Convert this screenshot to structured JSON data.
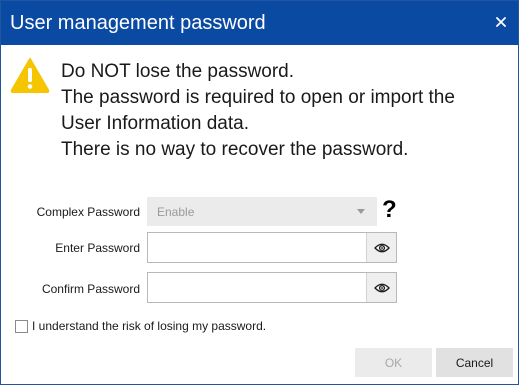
{
  "window": {
    "title": "User management password",
    "close_glyph": "×"
  },
  "warning": {
    "icon": "warning-triangle-icon",
    "icon_color": "#f5c500",
    "lines": [
      "Do NOT lose the password.",
      "The password is required to open or import the",
      "User Information data.",
      "There is no way to recover the password."
    ]
  },
  "form": {
    "complex_password": {
      "label": "Complex Password",
      "value": "Enable",
      "help_glyph": "?"
    },
    "enter_password": {
      "label": "Enter Password",
      "value": "",
      "toggle_icon": "eye-icon"
    },
    "confirm_password": {
      "label": "Confirm Password",
      "value": "",
      "toggle_icon": "eye-icon"
    },
    "acknowledge": {
      "label": "I understand the risk of losing my password.",
      "checked": false
    }
  },
  "buttons": {
    "ok_label": "OK",
    "cancel_label": "Cancel"
  },
  "colors": {
    "titlebar": "#0b4aa2",
    "warning": "#f5c500"
  }
}
